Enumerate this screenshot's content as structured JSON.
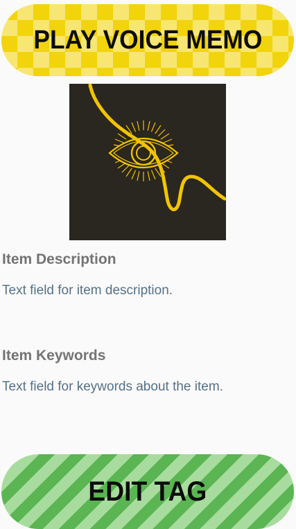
{
  "buttons": {
    "play_voice_memo_label": "PLAY VOICE MEMO",
    "edit_tag_label": "EDIT TAG"
  },
  "description": {
    "label": "Item Description",
    "text": "Text field for item description."
  },
  "keywords": {
    "label": "Item Keywords",
    "text": "Text field for keywords about the item."
  },
  "image": {
    "icon": "eye-icon"
  },
  "colors": {
    "play_button": "#f2d40c",
    "edit_button": "#5ab552",
    "artwork_bg": "#2a2620",
    "artwork_line": "#f2c400",
    "label_text": "#737373",
    "field_text": "#557087"
  }
}
